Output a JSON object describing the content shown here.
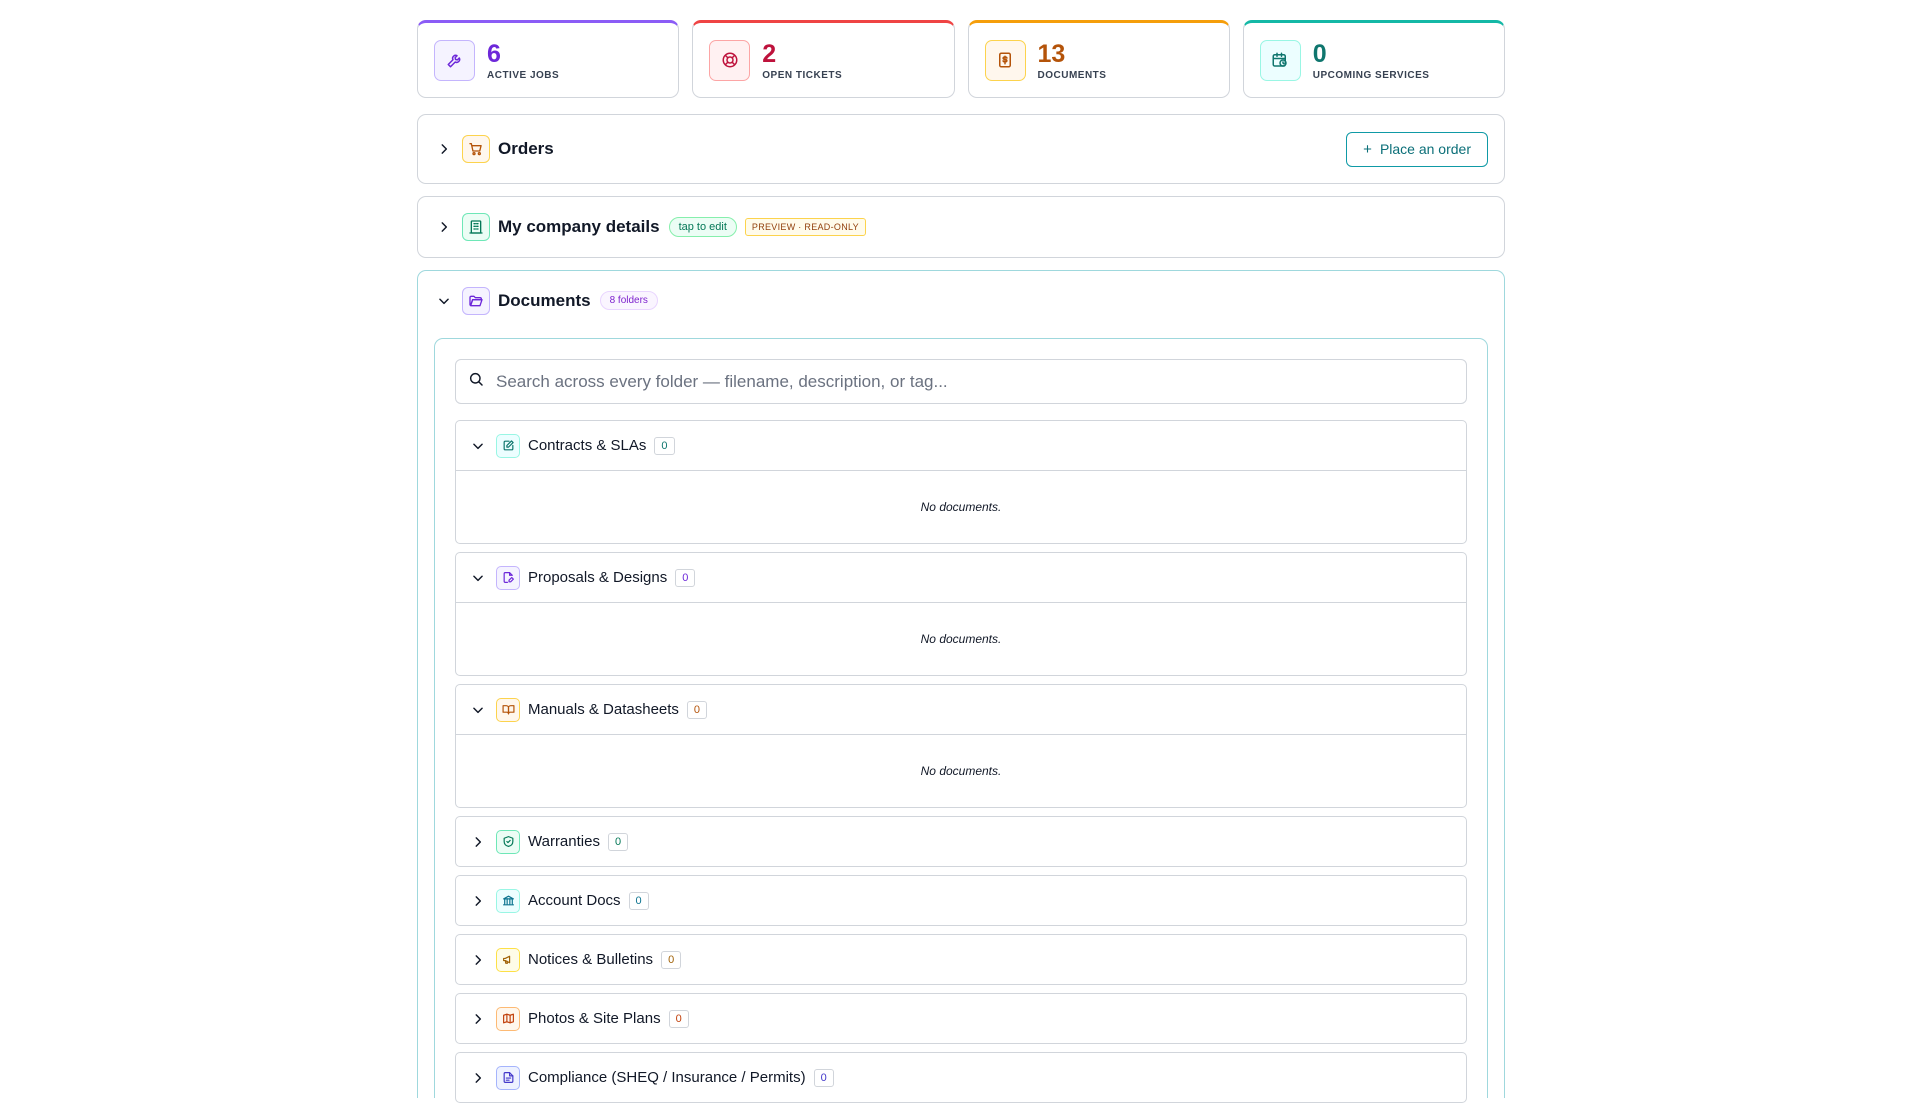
{
  "stats": [
    {
      "value": "6",
      "label": "ACTIVE JOBS",
      "icon": "wrench-icon",
      "color": "#6d28d9",
      "bg": "#f5f3ff",
      "border": "#a78bfa"
    },
    {
      "value": "2",
      "label": "OPEN TICKETS",
      "icon": "lifebuoy-icon",
      "color": "#be123c",
      "bg": "#fff1f2",
      "border": "#f87171"
    },
    {
      "value": "13",
      "label": "DOCUMENTS",
      "icon": "document-dollar-icon",
      "color": "#b45309",
      "bg": "#fff7ed",
      "border": "#f59e0b"
    },
    {
      "value": "0",
      "label": "UPCOMING SERVICES",
      "icon": "calendar-clock-icon",
      "color": "#0f766e",
      "bg": "#ecfeff",
      "border": "#14b8a6"
    }
  ],
  "orders": {
    "title": "Orders",
    "button": "Place an order"
  },
  "company": {
    "title": "My company details",
    "pill": "tap to edit",
    "tag": "PREVIEW · READ-ONLY"
  },
  "documents": {
    "title": "Documents",
    "pill": "8 folders",
    "search_placeholder": "Search across every folder — filename, description, or tag...",
    "empty_text": "No documents.",
    "folders": [
      {
        "name": "Contracts & SLAs",
        "count": "0",
        "expanded": true,
        "icon": "edit-document-icon"
      },
      {
        "name": "Proposals & Designs",
        "count": "0",
        "expanded": true,
        "icon": "file-pen-icon"
      },
      {
        "name": "Manuals & Datasheets",
        "count": "0",
        "expanded": true,
        "icon": "open-book-icon"
      },
      {
        "name": "Warranties",
        "count": "0",
        "expanded": false,
        "icon": "shield-check-icon"
      },
      {
        "name": "Account Docs",
        "count": "0",
        "expanded": false,
        "icon": "bank-icon"
      },
      {
        "name": "Notices & Bulletins",
        "count": "0",
        "expanded": false,
        "icon": "megaphone-icon"
      },
      {
        "name": "Photos & Site Plans",
        "count": "0",
        "expanded": false,
        "icon": "map-icon"
      },
      {
        "name": "Compliance (SHEQ / Insurance / Permits)",
        "count": "0",
        "expanded": false,
        "icon": "file-text-icon"
      }
    ]
  }
}
